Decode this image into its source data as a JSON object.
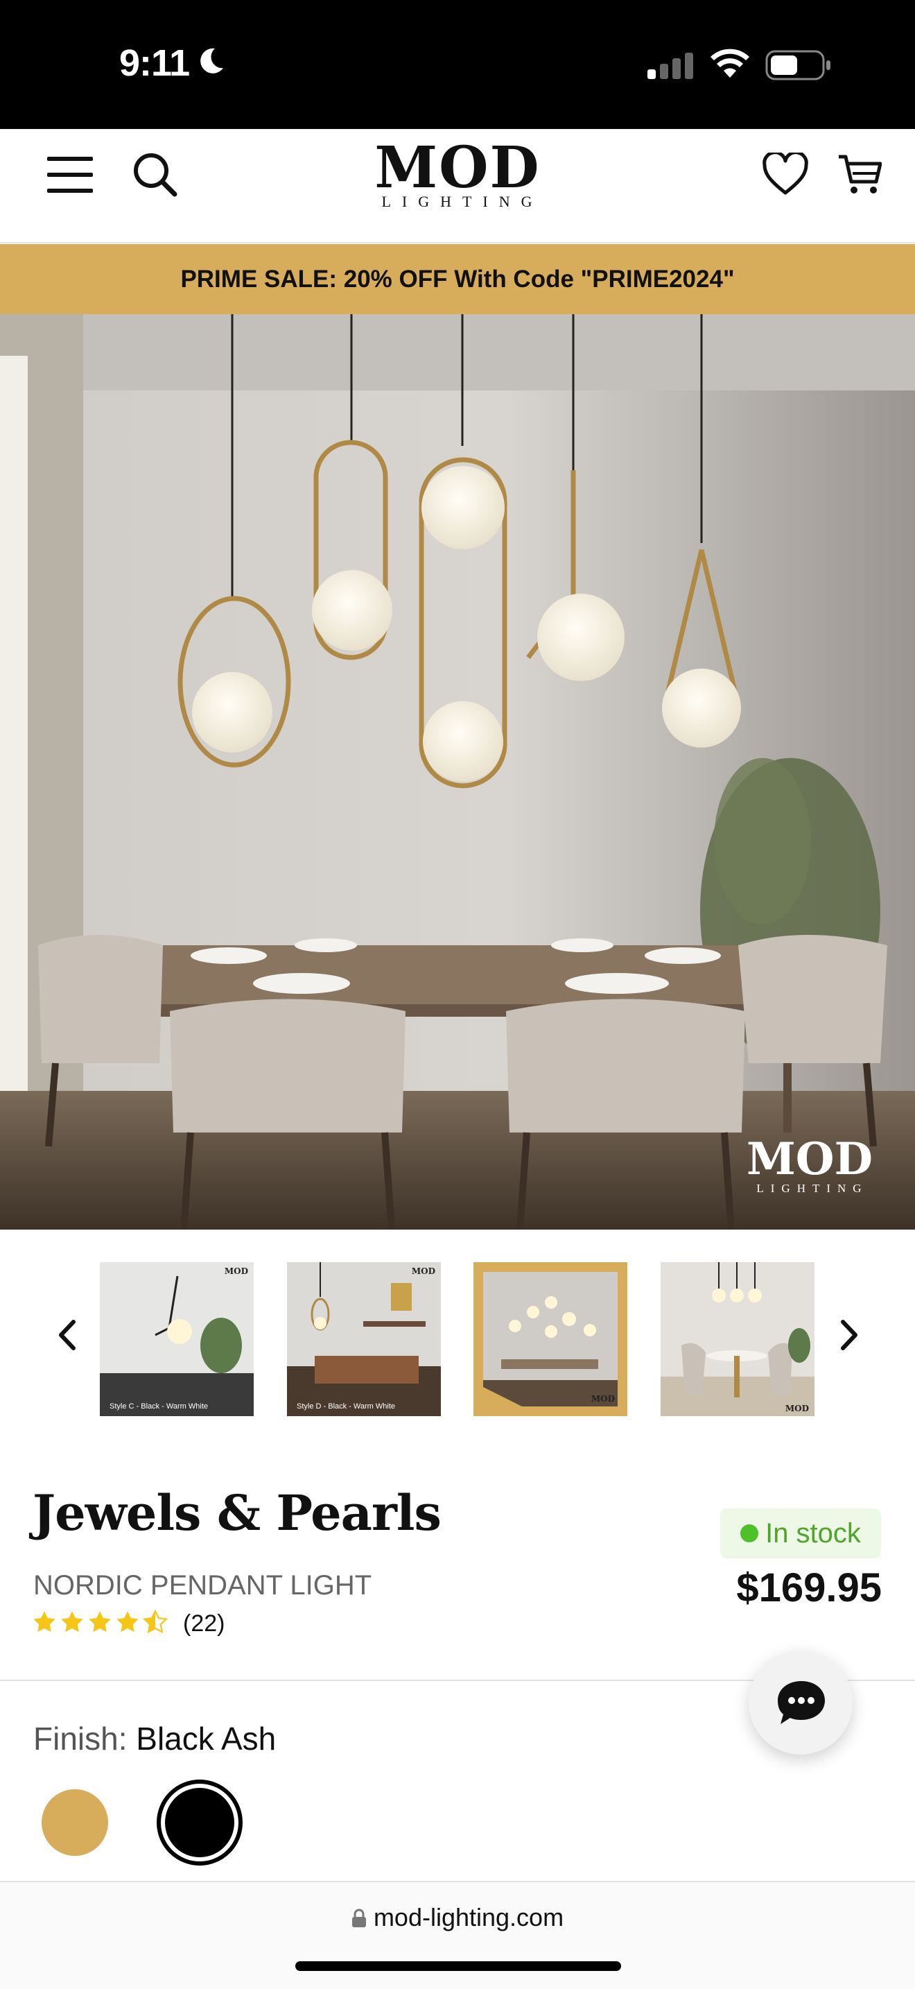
{
  "status_bar": {
    "time": "9:11"
  },
  "header": {
    "logo_main": "MOD",
    "logo_sub": "LIGHTING",
    "icons": [
      "menu-icon",
      "search-icon",
      "heart-icon",
      "cart-icon"
    ]
  },
  "promo": {
    "text": "PRIME SALE: 20% OFF With Code \"PRIME2024\""
  },
  "hero": {
    "watermark_main": "MOD",
    "watermark_sub": "LIGHTING"
  },
  "thumbnails": [
    {
      "caption": "Style C - Black - Warm White",
      "selected": false
    },
    {
      "caption": "Style D - Black - Warm White",
      "selected": false
    },
    {
      "caption": "",
      "selected": true
    },
    {
      "caption": "",
      "selected": false
    }
  ],
  "product": {
    "title": "Jewels & Pearls",
    "subtitle": "NORDIC PENDANT LIGHT",
    "rating": 4.5,
    "review_count": "(22)",
    "stock": "In stock",
    "price": "$169.95"
  },
  "finish": {
    "label": "Finish:",
    "value": "Black Ash",
    "options": [
      {
        "name": "Gold",
        "color": "#d7ad5c",
        "selected": false
      },
      {
        "name": "Black Ash",
        "color": "#000000",
        "selected": true
      }
    ]
  },
  "browser": {
    "url": "mod-lighting.com"
  },
  "colors": {
    "accent": "#d7ad5c",
    "stock_green": "#4ec12a",
    "stock_bg": "#eef8e6"
  }
}
